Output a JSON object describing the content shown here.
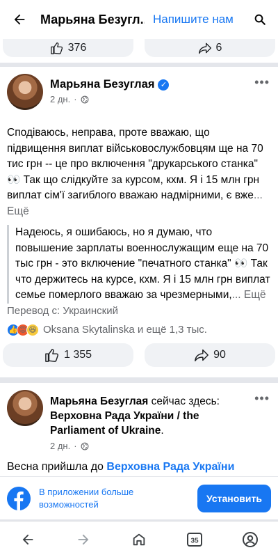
{
  "topbar": {
    "title": "Марьяна Безугл...",
    "message_link": "Напишите нам"
  },
  "prev_post": {
    "like_count": "376",
    "share_count": "6"
  },
  "post": {
    "author": "Марьяна Безуглая",
    "time": "2 дн.",
    "text": "Сподіваюсь, неправа, проте вважаю, що підвищення виплат військовослужбовцям ще на 70 тис грн -- це про включення \"друкарського станка\" 👀 Так що слідкуйте за курсом, кхм. Я і 15 млн грн виплат сім'ї загиблого вважаю надмірними, є вже",
    "see_more": "... Ещё",
    "translation_text": "Надеюсь, я ошибаюсь, но я думаю, что повышение зарплаты военнослужащим еще на 70 тыс грн - это включение \"печатного станка\" 👀 Так что держитесь на курсе, кхм. Я і 15 млн грн виплат семье померлого вважаю за чрезмерными,",
    "translation_more": "... Ещё",
    "translated_from": "Перевод с: Украинский",
    "reactions_text": "Oksana Skytalinska и ещё 1,3 тыс.",
    "like_count": "1 355",
    "share_count": "90"
  },
  "post2": {
    "author": "Марьяна Безуглая",
    "checkin_prefix": " сейчас здесь: ",
    "place": "Верховна Рада України / the Parliament of Ukraine",
    "period": ".",
    "time": "2 дн.",
    "text_prefix": "Весна прийшла до ",
    "text_link": "Верховна Рада України"
  },
  "banner": {
    "text": "В приложении больше возможностей",
    "install_label": "Установить"
  },
  "navbar": {
    "tabs_count": "35"
  },
  "colors": {
    "accent": "#1877f2",
    "secondary_text": "#65676b"
  }
}
